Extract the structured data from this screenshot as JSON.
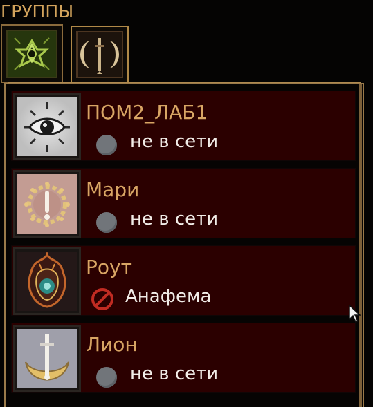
{
  "header": {
    "title": "ГРУППЫ"
  },
  "tabs": [
    {
      "icon": "green-sun-emblem-icon",
      "selected": false
    },
    {
      "icon": "moon-dagger-emblem-icon",
      "selected": true
    }
  ],
  "groups": [
    {
      "name": "ПОМ2_ЛАБ1",
      "status": "не в сети",
      "status_icon": "offline-dot-icon",
      "avatar_icon": "eye-emblem-icon"
    },
    {
      "name": "Мари",
      "status": "не в сети",
      "status_icon": "offline-dot-icon",
      "avatar_icon": "sun-ring-emblem-icon"
    },
    {
      "name": "Роут",
      "status": "Анафема",
      "status_icon": "anathema-ban-icon",
      "avatar_icon": "flame-eye-emblem-icon"
    },
    {
      "name": "Лион",
      "status": "не в сети",
      "status_icon": "offline-dot-icon",
      "avatar_icon": "sword-crescent-emblem-icon"
    }
  ],
  "colors": {
    "row_background": "#2b0000",
    "name_text": "#d8a564",
    "status_text": "#f1ece7",
    "border_gold": "#9a7a4a",
    "offline_dot": "#71757a",
    "anathema_red": "#c12b22"
  }
}
